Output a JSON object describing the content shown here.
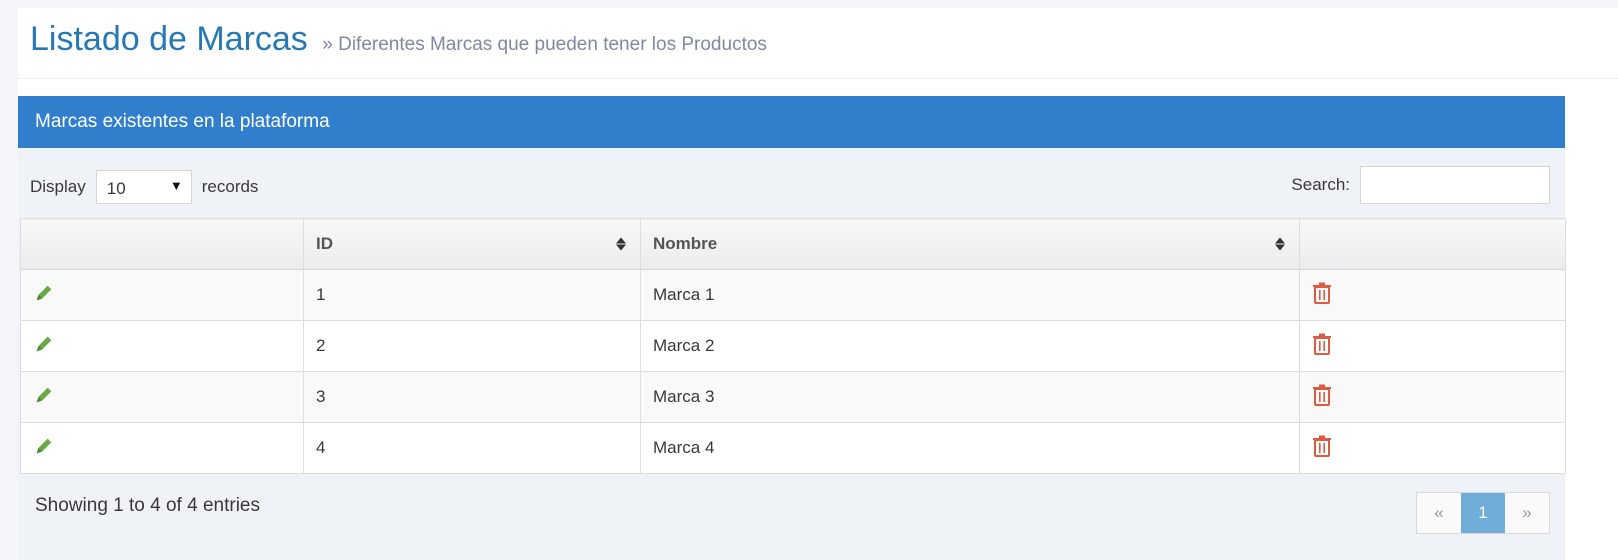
{
  "header": {
    "title": "Listado de Marcas",
    "subtitle": "» Diferentes Marcas que pueden tener los Productos"
  },
  "panel": {
    "title": "Marcas existentes en la plataforma",
    "length": {
      "prefix": "Display",
      "selected": "10",
      "suffix": "records"
    },
    "search": {
      "label": "Search:",
      "value": ""
    },
    "table": {
      "columns": [
        "",
        "ID",
        "Nombre",
        ""
      ],
      "rows": [
        {
          "id": "1",
          "nombre": "Marca 1"
        },
        {
          "id": "2",
          "nombre": "Marca 2"
        },
        {
          "id": "3",
          "nombre": "Marca 3"
        },
        {
          "id": "4",
          "nombre": "Marca 4"
        }
      ]
    },
    "info": "Showing 1 to 4 of 4 entries",
    "pagination": {
      "prev": "«",
      "current": "1",
      "next": "»"
    }
  },
  "colors": {
    "title": "#2679b5",
    "panel_header": "#307ecc",
    "edit_icon": "#69aa46",
    "delete_icon": "#dd5a43",
    "active_page": "#6faed9"
  },
  "icons": {
    "edit": "pencil-icon",
    "delete": "trash-icon",
    "sort": "sort-icon",
    "select": "caret-down-icon"
  }
}
